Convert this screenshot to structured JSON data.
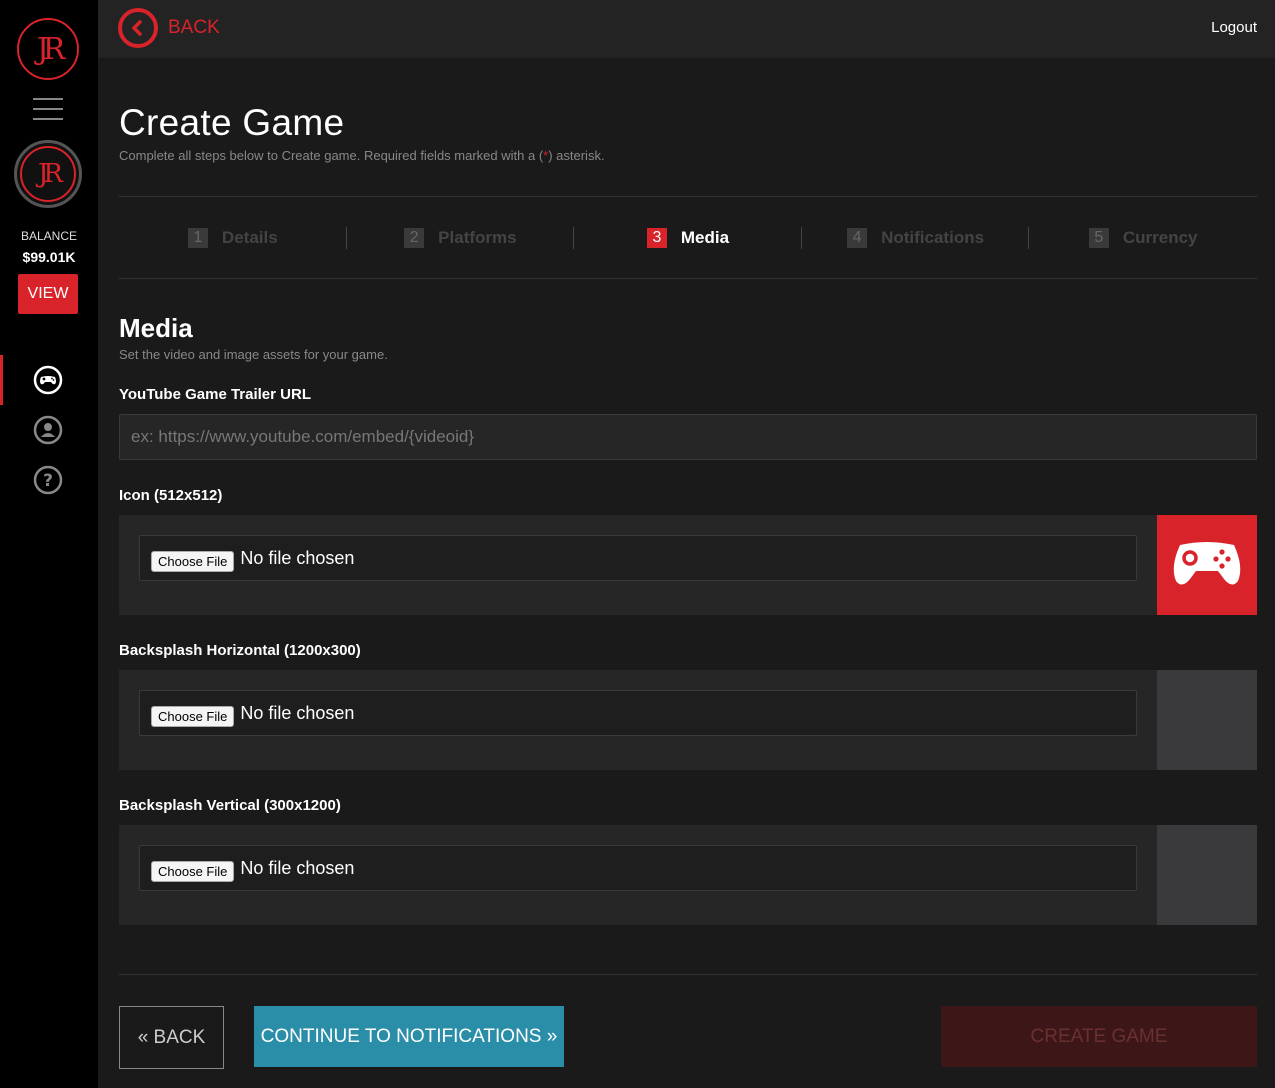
{
  "sidebar": {
    "logo_text": "JR",
    "avatar_text": "JR",
    "balance_label": "BALANCE",
    "balance_value": "$99.01K",
    "view_label": "VIEW",
    "nav": [
      {
        "icon": "gamepad-icon",
        "active": true
      },
      {
        "icon": "user-icon",
        "active": false
      },
      {
        "icon": "help-icon",
        "active": false
      }
    ]
  },
  "topbar": {
    "back_label": "BACK",
    "logout_label": "Logout"
  },
  "page": {
    "title": "Create Game",
    "subtitle_pre": "Complete all steps below to Create game. Required fields marked with a (",
    "subtitle_req": "*",
    "subtitle_post": ") asterisk."
  },
  "steps": [
    {
      "num": "1",
      "label": "Details",
      "active": false
    },
    {
      "num": "2",
      "label": "Platforms",
      "active": false
    },
    {
      "num": "3",
      "label": "Media",
      "active": true
    },
    {
      "num": "4",
      "label": "Notifications",
      "active": false
    },
    {
      "num": "5",
      "label": "Currency",
      "active": false
    }
  ],
  "section": {
    "title": "Media",
    "subtitle": "Set the video and image assets for your game."
  },
  "fields": {
    "youtube_label": "YouTube Game Trailer URL",
    "youtube_placeholder": "ex: https://www.youtube.com/embed/{videoid}",
    "youtube_value": "",
    "icon_label": "Icon (512x512)",
    "backsplash_h_label": "Backsplash Horizontal (1200x300)",
    "backsplash_v_label": "Backsplash Vertical (300x1200)",
    "choose_file_label": "Choose File",
    "no_file_label": "No file chosen"
  },
  "actions": {
    "back_label": "« BACK",
    "continue_label": "CONTINUE TO NOTIFICATIONS »",
    "create_label": "CREATE GAME"
  },
  "colors": {
    "accent": "#d8232a",
    "continue": "#2a8ea8",
    "create_disabled": "#3d1718"
  }
}
